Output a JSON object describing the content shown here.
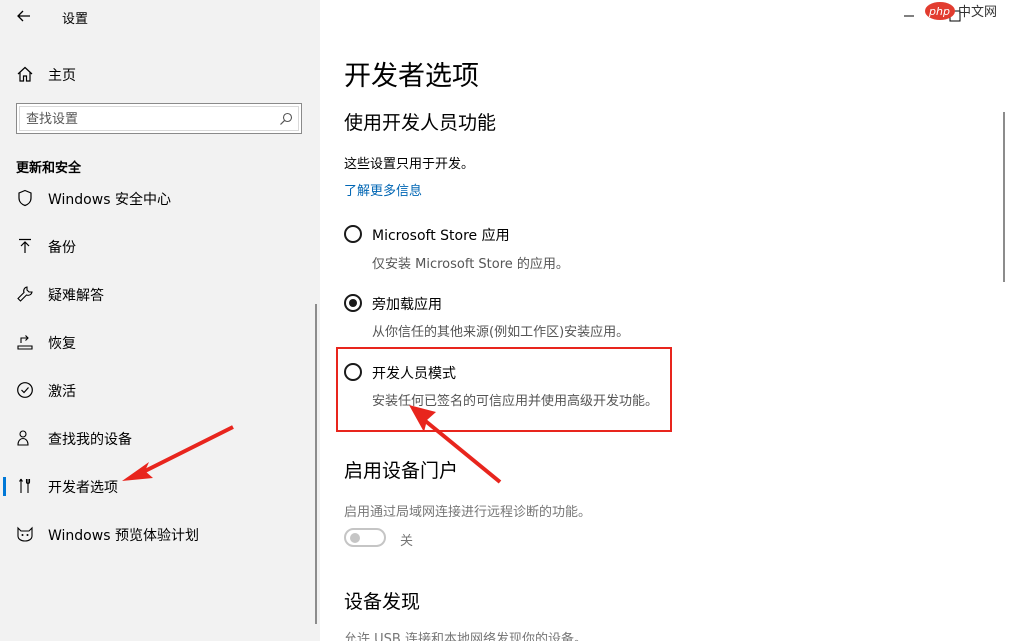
{
  "app": {
    "title": "设置"
  },
  "sidebar": {
    "home_label": "主页",
    "search_placeholder": "查找设置",
    "section_title": "更新和安全",
    "items": [
      {
        "label": "Windows 安全中心",
        "icon": "shield-icon"
      },
      {
        "label": "备份",
        "icon": "backup-arrow-icon"
      },
      {
        "label": "疑难解答",
        "icon": "wrench-icon"
      },
      {
        "label": "恢复",
        "icon": "recovery-icon"
      },
      {
        "label": "激活",
        "icon": "check-circle-icon"
      },
      {
        "label": "查找我的设备",
        "icon": "person-location-icon"
      },
      {
        "label": "开发者选项",
        "icon": "developer-tools-icon",
        "selected": true
      },
      {
        "label": "Windows 预览体验计划",
        "icon": "insider-cat-icon"
      }
    ]
  },
  "main": {
    "title": "开发者选项",
    "section1": {
      "heading": "使用开发人员功能",
      "desc": "这些设置只用于开发。",
      "link": "了解更多信息",
      "options": [
        {
          "label": "Microsoft Store 应用",
          "desc": "仅安装 Microsoft Store 的应用。",
          "checked": false
        },
        {
          "label": "旁加载应用",
          "desc": "从你信任的其他来源(例如工作区)安装应用。",
          "checked": true
        },
        {
          "label": "开发人员模式",
          "desc": "安装任何已签名的可信应用并使用高级开发功能。",
          "checked": false
        }
      ]
    },
    "section2": {
      "heading": "启用设备门户",
      "desc": "启用通过局域网连接进行远程诊断的功能。",
      "toggle_state": "关",
      "toggle_on": false
    },
    "section3": {
      "heading": "设备发现",
      "desc": "允许 USB 连接和本地网络发现你的设备。"
    }
  },
  "watermark": {
    "text": "php 中文网"
  },
  "colors": {
    "sidebar_bg": "#f2f2f2",
    "accent": "#0078d7",
    "link": "#0066b4",
    "annotation_red": "#e8251d"
  }
}
